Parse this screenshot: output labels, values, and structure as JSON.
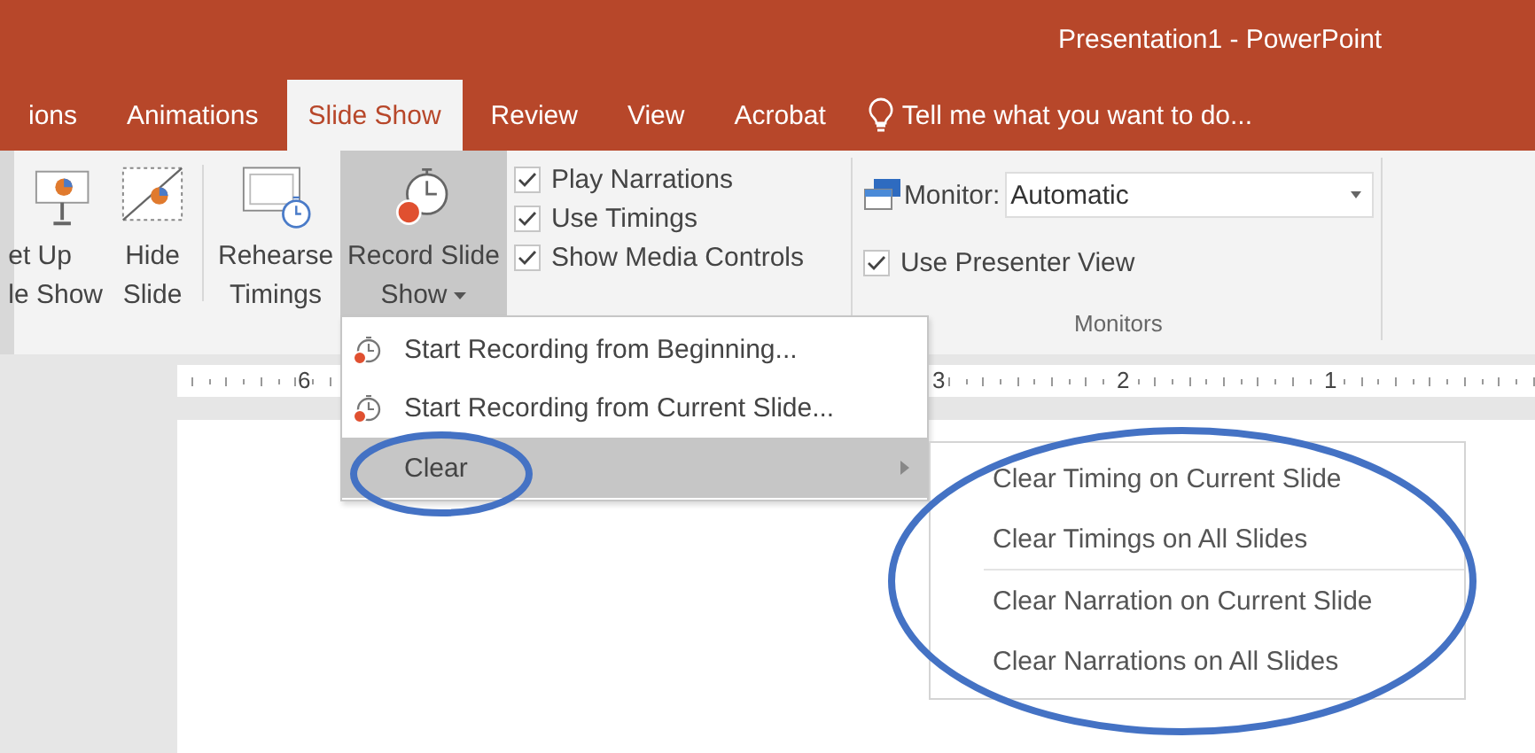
{
  "window": {
    "title": "Presentation1 - PowerPoint"
  },
  "tabs": [
    {
      "label": "ions",
      "selected": false
    },
    {
      "label": "Animations",
      "selected": false
    },
    {
      "label": "Slide Show",
      "selected": true
    },
    {
      "label": "Review",
      "selected": false
    },
    {
      "label": "View",
      "selected": false
    },
    {
      "label": "Acrobat",
      "selected": false
    }
  ],
  "tell_me": {
    "placeholder": "Tell me what you want to do..."
  },
  "ribbon_buttons": [
    {
      "kind": "setup",
      "lines": [
        "et Up",
        "le Show"
      ],
      "pressed": false,
      "dropdown": false
    },
    {
      "kind": "hide",
      "lines": [
        "Hide",
        "Slide"
      ],
      "pressed": false,
      "dropdown": false
    },
    {
      "kind": "rehearse",
      "lines": [
        "Rehearse",
        "Timings"
      ],
      "pressed": false,
      "dropdown": false
    },
    {
      "kind": "record",
      "lines": [
        "Record Slide",
        "Show"
      ],
      "pressed": true,
      "dropdown": true
    }
  ],
  "options": [
    {
      "label": "Play Narrations",
      "checked": true
    },
    {
      "label": "Use Timings",
      "checked": true
    },
    {
      "label": "Show Media Controls",
      "checked": true
    }
  ],
  "monitors": {
    "monitor_label": "Monitor:",
    "monitor_value": "Automatic",
    "presenter_view": {
      "label": "Use Presenter View",
      "checked": true
    },
    "group_label": "Monitors"
  },
  "ruler": {
    "labels": [
      "6",
      "3",
      "2",
      "1"
    ]
  },
  "menu": {
    "items": [
      {
        "kind": "record",
        "label": "Start Recording from Beginning...",
        "highlighted": false,
        "circled": false
      },
      {
        "kind": "record",
        "label": "Start Recording from Current Slide...",
        "highlighted": false,
        "circled": false
      },
      {
        "kind": "submenu",
        "label": "Clear",
        "highlighted": true,
        "circled": true
      }
    ]
  },
  "submenu": {
    "circled": true,
    "items": [
      {
        "label": "Clear Timing on Current Slide",
        "separator_before": false
      },
      {
        "label": "Clear Timings on All Slides",
        "separator_before": false
      },
      {
        "label": "Clear Narration on Current Slide",
        "separator_before": true
      },
      {
        "label": "Clear Narrations on All Slides",
        "separator_before": false
      }
    ]
  }
}
